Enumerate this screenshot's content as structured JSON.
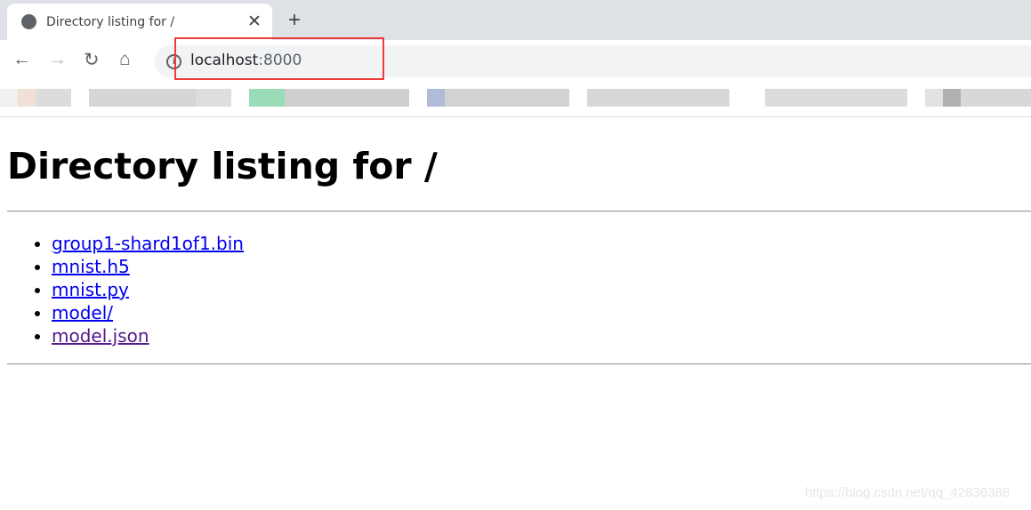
{
  "browser": {
    "tab_title": "Directory listing for /",
    "tab_icon": "globe-icon",
    "url_host": "localhost",
    "url_port": ":8000",
    "highlight_color": "#ef3b3b"
  },
  "page": {
    "heading": "Directory listing for /",
    "files": [
      {
        "name": "group1-shard1of1.bin",
        "visited": false
      },
      {
        "name": "mnist.h5",
        "visited": false
      },
      {
        "name": "mnist.py",
        "visited": false
      },
      {
        "name": "model/",
        "visited": false
      },
      {
        "name": "model.json",
        "visited": true
      }
    ],
    "link_color": "#0000ee",
    "visited_color": "#551a8b"
  },
  "watermark": "https://blog.csdn.net/qq_42836388"
}
